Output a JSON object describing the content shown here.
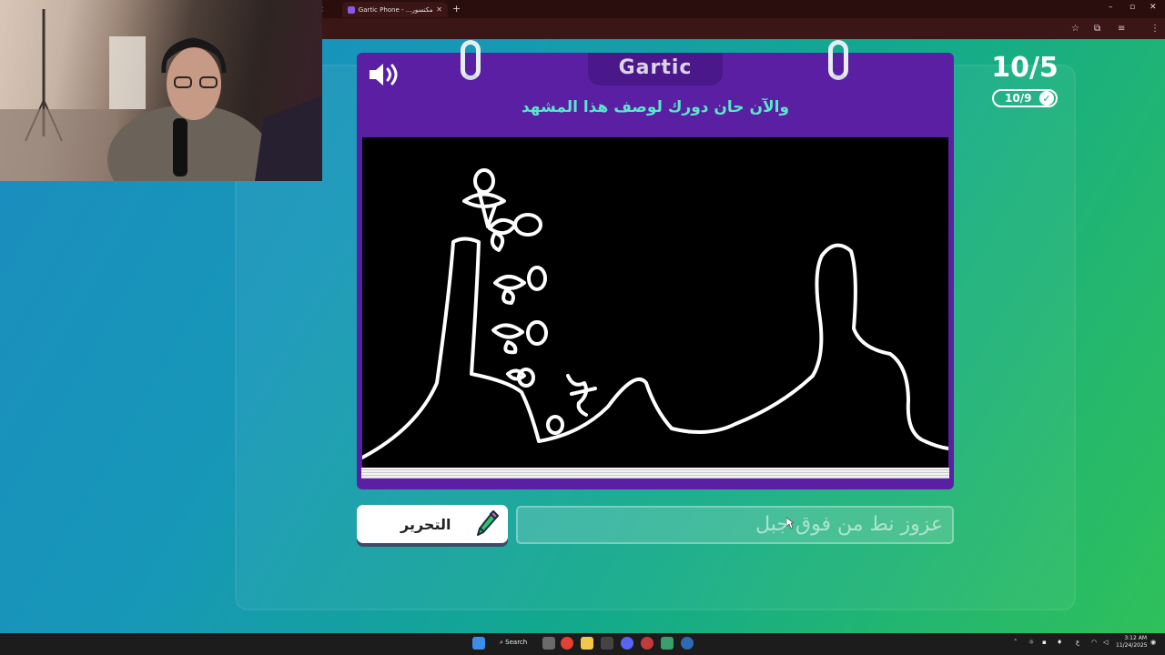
{
  "browser": {
    "tab_title": "Gartic Phone - ...الف المكتسور"
  },
  "game": {
    "logo": "Gartic",
    "prompt": "والآن حان دورك لوصف هذا المشهد",
    "round_counter": "10/5",
    "done_badge": "10/9"
  },
  "controls": {
    "edit_button_label": "التحرير",
    "answer_text": "عزوز نط من فوق جبل"
  },
  "taskbar": {
    "search_label": "Search",
    "lang": "ع",
    "time": "3:12 AM",
    "date": "11/24/2025"
  }
}
